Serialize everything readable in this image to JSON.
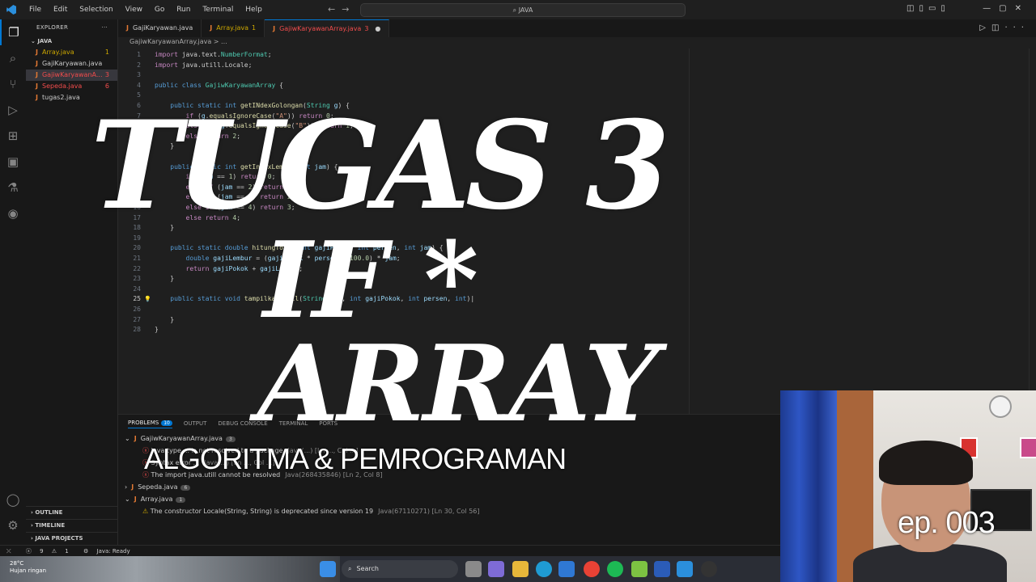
{
  "titlebar": {
    "menu": [
      "File",
      "Edit",
      "Selection",
      "View",
      "Go",
      "Run",
      "Terminal",
      "Help"
    ],
    "search": "JAVA"
  },
  "explorer": {
    "title": "EXPLORER",
    "folder": "JAVA",
    "files": [
      {
        "name": "Array.java",
        "count": "1",
        "status": "warn"
      },
      {
        "name": "GajiKaryawan.java",
        "count": "",
        "status": "norm"
      },
      {
        "name": "GajiwKaryawanA...",
        "count": "3",
        "status": "err",
        "selected": true
      },
      {
        "name": "Sepeda.java",
        "count": "6",
        "status": "err"
      },
      {
        "name": "tugas2.java",
        "count": "",
        "status": "norm"
      }
    ],
    "sections": [
      "OUTLINE",
      "TIMELINE",
      "JAVA PROJECTS"
    ]
  },
  "tabs": [
    {
      "label": "GajiKaryawan.java",
      "count": "",
      "status": "norm"
    },
    {
      "label": "Array.java",
      "count": "1",
      "status": "warn"
    },
    {
      "label": "GajiwKaryawanArray.java",
      "count": "3",
      "status": "err",
      "active": true
    }
  ],
  "breadcrumb": "GajiwKaryawanArray.java > ...",
  "code": {
    "lines": [
      {
        "n": "1",
        "html": "<span class='ctl'>import</span> <span class='pl'>java.text.</span><span class='ty'>NumberFormat</span><span class='pl'>;</span>"
      },
      {
        "n": "2",
        "html": "<span class='ctl'>import</span> <span class='pl'>java.utill.Locale;</span>"
      },
      {
        "n": "3",
        "html": ""
      },
      {
        "n": "4",
        "html": "<span class='kw'>public class</span> <span class='ty'>GajiwKaryawanArray</span> <span class='pl'>{</span>"
      },
      {
        "n": "5",
        "html": ""
      },
      {
        "n": "6",
        "html": "    <span class='kw'>public static int</span> <span class='fn'>getINdexGolongan</span><span class='pl'>(</span><span class='ty'>String</span> <span class='vr'>g</span><span class='pl'>) {</span>"
      },
      {
        "n": "7",
        "html": "        <span class='ctl'>if</span> <span class='pl'>(</span><span class='vr'>g</span><span class='pl'>.</span><span class='fn'>equalsIgnoreCase</span><span class='pl'>(</span><span class='st'>\"A\"</span><span class='pl'>))</span> <span class='ctl'>return</span> <span class='nm'>0</span><span class='pl'>;</span>"
      },
      {
        "n": "8",
        "html": "        <span class='ctl'>else if</span> <span class='pl'>(</span><span class='vr'>g</span><span class='pl'>.</span><span class='fn'>equalsIgnoreCase</span><span class='pl'>(</span><span class='st'>\"B\"</span><span class='pl'>))</span> <span class='ctl'>return</span> <span class='nm'>1</span><span class='pl'>;</span>"
      },
      {
        "n": "9",
        "html": "        <span class='ctl'>else</span> <span class='ctl'>return</span> <span class='nm'>2</span><span class='pl'>;</span>"
      },
      {
        "n": "10",
        "html": "    <span class='pl'>}</span>"
      },
      {
        "n": "11",
        "html": ""
      },
      {
        "n": "12",
        "html": "    <span class='kw'>public static int</span> <span class='fn'>getIndexLembur</span><span class='pl'>(</span><span class='kw'>int</span> <span class='vr'>jam</span><span class='pl'>) {</span>"
      },
      {
        "n": "13",
        "html": "        <span class='ctl'>if</span> <span class='pl'>(</span><span class='vr'>jam</span> <span class='pl'>==</span> <span class='nm'>1</span><span class='pl'>)</span> <span class='ctl'>return</span> <span class='nm'>0</span><span class='pl'>;</span>"
      },
      {
        "n": "14",
        "html": "        <span class='ctl'>else if</span> <span class='pl'>(</span><span class='vr'>jam</span> <span class='pl'>==</span> <span class='nm'>2</span><span class='pl'>)</span> <span class='ctl'>return</span> <span class='nm'>1</span><span class='pl'>;</span>"
      },
      {
        "n": "15",
        "html": "        <span class='ctl'>else if</span> <span class='pl'>(</span><span class='vr'>jam</span> <span class='pl'>==</span> <span class='nm'>3</span><span class='pl'>)</span> <span class='ctl'>return</span> <span class='nm'>2</span><span class='pl'>;</span>"
      },
      {
        "n": "16",
        "html": "        <span class='ctl'>else if</span> <span class='pl'>(</span><span class='vr'>jam</span> <span class='pl'>==</span> <span class='nm'>4</span><span class='pl'>)</span> <span class='ctl'>return</span> <span class='nm'>3</span><span class='pl'>;</span>"
      },
      {
        "n": "17",
        "html": "        <span class='ctl'>else</span> <span class='ctl'>return</span> <span class='nm'>4</span><span class='pl'>;</span>"
      },
      {
        "n": "18",
        "html": "    <span class='pl'>}</span>"
      },
      {
        "n": "19",
        "html": ""
      },
      {
        "n": "20",
        "html": "    <span class='kw'>public static double</span> <span class='fn'>hitungTotal</span><span class='pl'>(</span><span class='kw'>int</span> <span class='vr'>gajiPokok</span><span class='pl'>,</span> <span class='kw'>int</span> <span class='vr'>persen</span><span class='pl'>,</span> <span class='kw'>int</span> <span class='vr'>jam</span><span class='pl'>) {</span>"
      },
      {
        "n": "21",
        "html": "        <span class='kw'>double</span> <span class='vr'>gajiLembur</span> <span class='pl'>= (</span><span class='vr'>gajiPokok</span> <span class='pl'>*</span> <span class='vr'>persen</span> <span class='pl'>/</span> <span class='nm'>100.0</span><span class='pl'>) *</span> <span class='vr'>jam</span><span class='pl'>;</span>"
      },
      {
        "n": "22",
        "html": "        <span class='ctl'>return</span> <span class='vr'>gajiPokok</span> <span class='pl'>+</span> <span class='vr'>gajiLembur</span><span class='pl'>;</span>"
      },
      {
        "n": "23",
        "html": "    <span class='pl'>}</span>"
      },
      {
        "n": "24",
        "html": ""
      },
      {
        "n": "25",
        "html": "    <span class='kw'>public static void</span> <span class='fn'>tampilkanHasil</span><span class='pl'>(</span><span class='ty'>String</span> <span class='vr'>gol</span><span class='pl'>,</span> <span class='kw'>int</span> <span class='vr'>gajiPokok</span><span class='pl'>,</span> <span class='kw'>int</span> <span class='vr'>persen</span><span class='pl'>,</span> <span class='kw'>int</span><span class='pl'>)</span>",
        "current": true
      },
      {
        "n": "26",
        "html": ""
      },
      {
        "n": "27",
        "html": "    <span class='pl'>}</span>"
      },
      {
        "n": "28",
        "html": "<span class='pl'>}</span>"
      }
    ]
  },
  "panel": {
    "tabs": [
      {
        "label": "PROBLEMS",
        "badge": "10",
        "active": true
      },
      {
        "label": "OUTPUT"
      },
      {
        "label": "DEBUG CONSOLE"
      },
      {
        "label": "TERMINAL"
      },
      {
        "label": "PORTS"
      }
    ],
    "groups": [
      {
        "file": "GajiwKaryawanArray.java",
        "count": "3",
        "expanded": true,
        "items": [
          {
            "icon": "error",
            "text": "Java type ... is not resolved to a package",
            "loc": "Java(...)  [Ln ..., Col ...]"
          },
          {
            "icon": "error",
            "text": "Syntax error ...",
            "loc": "Java(...)  [Ln ..., Col ...]"
          },
          {
            "icon": "error",
            "text": "The import java.utill cannot be resolved",
            "loc": "Java(268435846)  [Ln 2, Col 8]"
          }
        ]
      },
      {
        "file": "Sepeda.java",
        "count": "6",
        "expanded": false,
        "items": []
      },
      {
        "file": "Array.java",
        "count": "1",
        "expanded": true,
        "items": [
          {
            "icon": "warn",
            "text": "The constructor Locale(String, String) is deprecated since version 19",
            "loc": "Java(67110271)  [Ln 30, Col 56]"
          }
        ]
      }
    ]
  },
  "statusbar": {
    "errors": "9",
    "warnings": "1",
    "java": "Java: Ready"
  },
  "taskbar": {
    "weather_temp": "28°C",
    "weather_desc": "Hujan ringan",
    "search": "Search"
  },
  "overlay": {
    "title": "TUGAS 3",
    "line2": "IF *",
    "line3": "ARRAY",
    "subtitle": "ALGORITMA & PEMROGRAMAN",
    "episode": "ep. 003"
  },
  "colors": {
    "accent": "#0078d4",
    "error": "#f14c4c",
    "warning": "#cca700",
    "java_icon": "#e37933"
  }
}
